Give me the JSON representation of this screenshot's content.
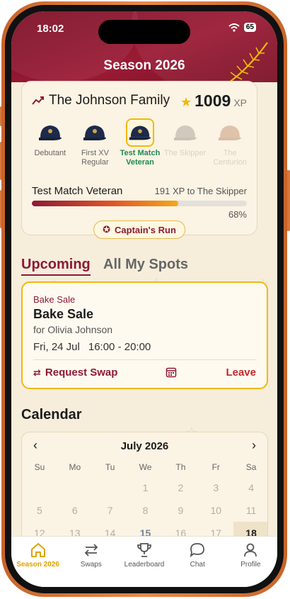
{
  "status_bar": {
    "time": "18:02",
    "battery": "65"
  },
  "header": {
    "title": "Season 2026"
  },
  "family": {
    "name": "The Johnson Family",
    "xp_value": "1009",
    "xp_unit": "XP",
    "badges": [
      {
        "label": "Debutant",
        "state": "earned"
      },
      {
        "label": "First XV Regular",
        "state": "earned"
      },
      {
        "label": "Test Match Veteran",
        "state": "current"
      },
      {
        "label": "The Skipper",
        "state": "locked"
      },
      {
        "label": "The Centurion",
        "state": "locked"
      }
    ],
    "current_level": "Test Match Veteran",
    "xp_to_next": "191 XP to The Skipper",
    "progress_percent": 68,
    "progress_label": "68%",
    "reward_button": "Captain's Run"
  },
  "tabs": [
    {
      "label": "Upcoming",
      "active": true
    },
    {
      "label": "All My Spots",
      "active": false
    }
  ],
  "upcoming_event": {
    "category": "Bake Sale",
    "title": "Bake Sale",
    "for": "for Olivia Johnson",
    "date": "Fri, 24 Jul",
    "time": "16:00 - 20:00",
    "swap_label": "Request Swap",
    "leave_label": "Leave"
  },
  "calendar": {
    "title": "Calendar",
    "month": "July 2026",
    "weekdays": [
      "Su",
      "Mo",
      "Tu",
      "We",
      "Th",
      "Fr",
      "Sa"
    ],
    "weeks": [
      [
        "",
        "",
        "",
        "1",
        "2",
        "3",
        "4"
      ],
      [
        "5",
        "6",
        "7",
        "8",
        "9",
        "10",
        "11"
      ],
      [
        "12",
        "13",
        "14",
        "15",
        "16",
        "17",
        "18"
      ]
    ],
    "today": "15",
    "selected": "18"
  },
  "nav": [
    {
      "label": "Season 2026",
      "icon": "home-icon",
      "active": true
    },
    {
      "label": "Swaps",
      "icon": "swap-arrows-icon",
      "active": false
    },
    {
      "label": "Leaderboard",
      "icon": "trophy-icon",
      "active": false
    },
    {
      "label": "Chat",
      "icon": "chat-bubble-icon",
      "active": false
    },
    {
      "label": "Profile",
      "icon": "person-icon",
      "active": false
    }
  ],
  "colors": {
    "header": "#8c1a36",
    "accent": "#8c1a36",
    "highlight": "#f0b90c",
    "active_nav": "#e0a200",
    "leave": "#c0282c"
  }
}
